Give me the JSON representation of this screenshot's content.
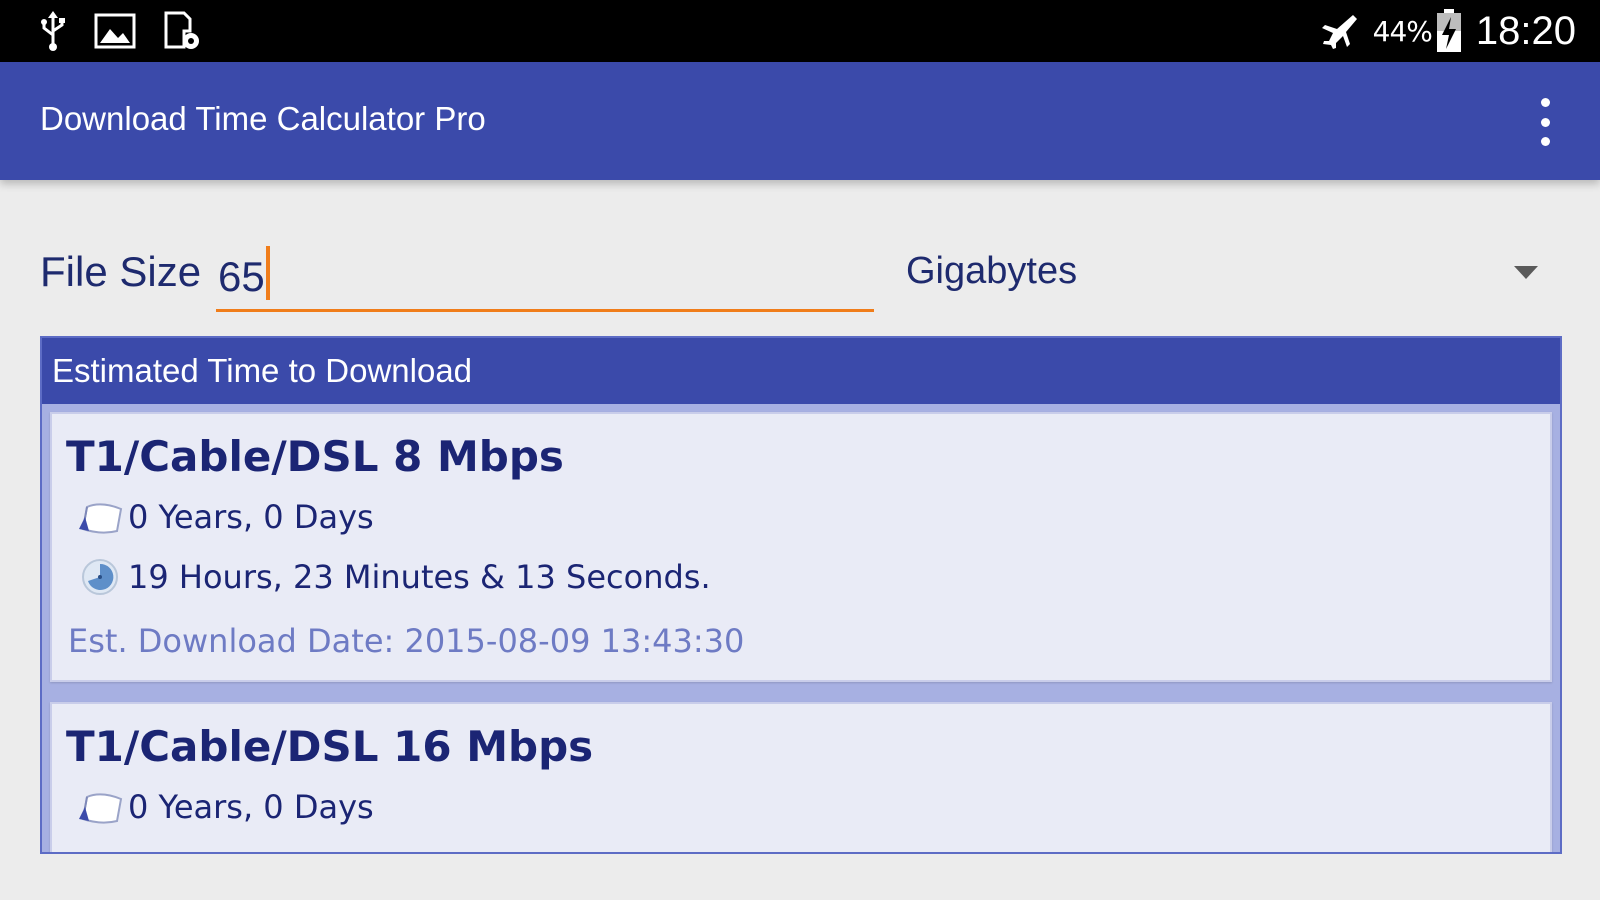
{
  "status_bar": {
    "left_icons": [
      "usb-icon",
      "image-icon",
      "sim-settings-icon"
    ],
    "right_icons": [
      "airplane-mode-icon",
      "battery-charging-icon"
    ],
    "battery_percent": "44%",
    "clock": "18:20",
    "background": "#000000"
  },
  "app_bar": {
    "title": "Download Time Calculator Pro",
    "menu_icon": "overflow-menu-icon",
    "background": "#3b4aaa"
  },
  "input": {
    "label": "File Size",
    "value": "65",
    "underline_color": "#f07d1a",
    "unit_selected": "Gigabytes",
    "dropdown_icon": "dropdown-arrow-icon"
  },
  "results": {
    "header": "Estimated Time to Download",
    "items": [
      {
        "title": "T1/Cable/DSL 8 Mbps",
        "days_icon": "calendar-icon",
        "days": "0 Years, 0 Days",
        "time_icon": "clock-icon",
        "time": "19 Hours, 23 Minutes & 13 Seconds.",
        "date": "Est. Download Date: 2015-08-09 13:43:30"
      },
      {
        "title": "T1/Cable/DSL 16 Mbps",
        "days_icon": "calendar-icon",
        "days": "0 Years, 0 Days"
      }
    ]
  },
  "colors": {
    "accent": "#f07d1a",
    "primary": "#3b4aaa",
    "card_background": "#e9ebf6",
    "text_dark": "#1b2574",
    "text_muted": "#6e7bc4"
  }
}
